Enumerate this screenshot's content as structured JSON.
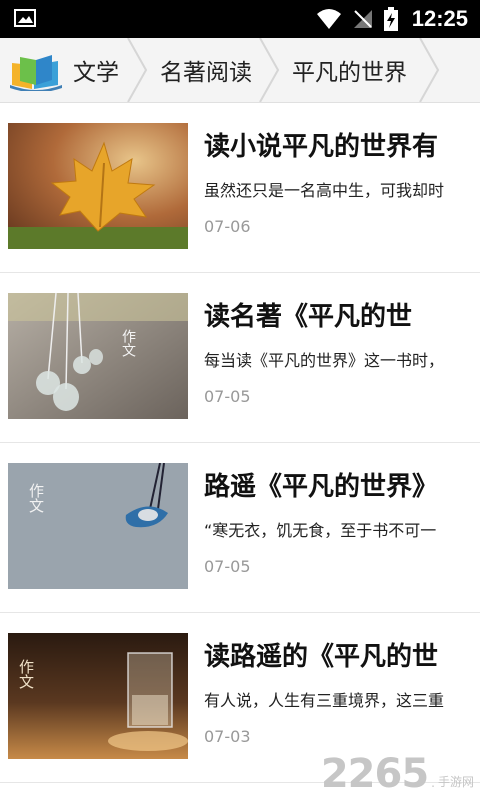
{
  "status_bar": {
    "time": "12:25"
  },
  "breadcrumb": {
    "items": [
      {
        "label": "文学"
      },
      {
        "label": "名著阅读"
      },
      {
        "label": "平凡的世界"
      }
    ]
  },
  "articles": [
    {
      "title": "读小说平凡的世界有",
      "summary": "虽然还只是一名高中生，可我却时",
      "date": "07-06",
      "thumb_text": ""
    },
    {
      "title": "读名著《平凡的世",
      "summary": "每当读《平凡的世界》这一书时，",
      "date": "07-05",
      "thumb_text": "作文"
    },
    {
      "title": "路遥《平凡的世界》",
      "summary": "“寒无衣，饥无食，至于书不可一",
      "date": "07-05",
      "thumb_text": "作文"
    },
    {
      "title": "读路遥的《平凡的世",
      "summary": "有人说，人生有三重境界，这三重",
      "date": "07-03",
      "thumb_text": "作文"
    }
  ],
  "watermark": {
    "number": "2265",
    "suffix": "手游网",
    "dot": ".",
    "colors": [
      "#c6c6c6"
    ]
  }
}
